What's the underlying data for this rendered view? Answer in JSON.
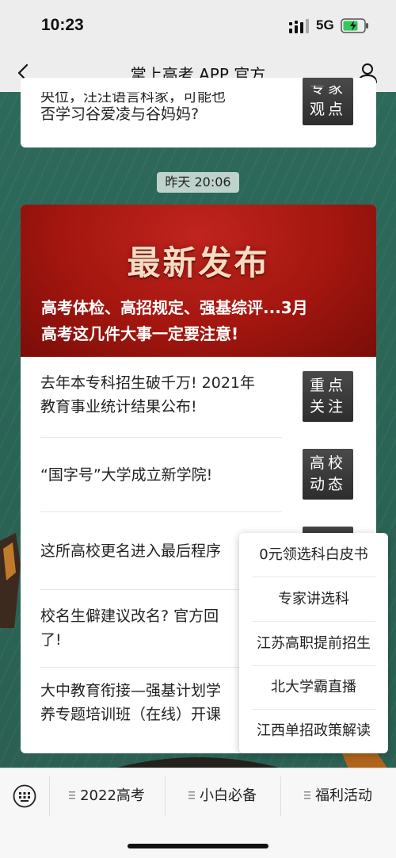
{
  "status_bar": {
    "time": "10:23",
    "network": "5G"
  },
  "nav": {
    "title": "掌上高考 APP 官方",
    "back_icon": "chevron-left-icon",
    "profile_icon": "person-icon"
  },
  "top_card": {
    "line1_partial": "央位，汪汪语言科家，可能也",
    "line2": "否学习谷爱凌与谷妈妈?",
    "tag": [
      "专家",
      "观点"
    ]
  },
  "timestamp": "昨天 20:06",
  "main_card": {
    "banner_title": "最新发布",
    "banner_subtitle_line1": "高考体检、高招规定、强基综评...3月",
    "banner_subtitle_line2": "高考这几件大事一定要注意!",
    "items": [
      {
        "line1": "去年本专科招生破千万! 2021年",
        "line2": "教育事业统计结果公布!",
        "tag1": "重点",
        "tag2": "关注"
      },
      {
        "line1": "“国字号”大学成立新学院!",
        "line2": "",
        "tag1": "高校",
        "tag2": "动态"
      },
      {
        "line1": "这所高校更名进入最后程序",
        "line2": "",
        "tag1": "",
        "tag2": ""
      },
      {
        "line1": "校名生僻建议改名? 官方回",
        "line2": "了!",
        "tag1": "",
        "tag2": ""
      },
      {
        "line1": "大中教育衔接—强基计划学",
        "line2": "养专题培训班（在线）开课",
        "tag1": "",
        "tag2": ""
      }
    ]
  },
  "popup_menu": {
    "items": [
      "0元领选科白皮书",
      "专家讲选科",
      "江苏高职提前招生",
      "北大学霸直播",
      "江西单招政策解读"
    ]
  },
  "menu_bar": {
    "keyboard_icon": "keyboard-icon",
    "buttons": [
      "2022高考",
      "小白必备",
      "福利活动"
    ]
  },
  "colors": {
    "background": "#2f6a5c",
    "banner_red": "#a3160f",
    "tag_dark": "#3a3a3a"
  }
}
